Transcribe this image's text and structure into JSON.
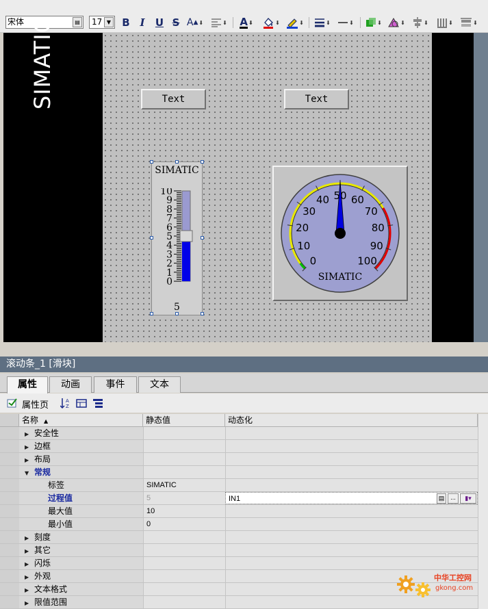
{
  "toolbar": {
    "font_name": "宋体",
    "font_size": "17",
    "bold": "B",
    "italic": "I",
    "underline": "U",
    "strike": "S",
    "case": "A",
    "font_color": "A"
  },
  "canvas": {
    "left_label": "SIMATIC",
    "button1_text": "Text",
    "button2_text": "Text",
    "slider": {
      "title": "SIMATIC",
      "scale_labels": [
        "10",
        "9",
        "8",
        "7",
        "6",
        "5",
        "4",
        "3",
        "2",
        "1",
        "0"
      ],
      "value": "5",
      "min": 0,
      "max": 10
    },
    "gauge": {
      "label": "SIMATIC",
      "scale_labels": [
        "0",
        "10",
        "20",
        "30",
        "40",
        "50",
        "60",
        "70",
        "80",
        "90",
        "100"
      ],
      "value": 50,
      "min": 0,
      "max": 100,
      "colors": {
        "face": "#9d9fd0",
        "needle": "#0000e0",
        "warning": "#e8e800",
        "danger": "#e00000",
        "ok": "#00c000"
      }
    }
  },
  "properties": {
    "title": "滚动条_1 [滑块]",
    "tabs": [
      "属性",
      "动画",
      "事件",
      "文本"
    ],
    "active_tab": "属性",
    "toolbar_label": "属性页",
    "columns": {
      "name": "名称",
      "static": "静态值",
      "dynamic": "动态化"
    },
    "rows": [
      {
        "name": "安全性",
        "expandable": true,
        "expanded": false
      },
      {
        "name": "边框",
        "expandable": true,
        "expanded": false
      },
      {
        "name": "布局",
        "expandable": true,
        "expanded": false
      },
      {
        "name": "常规",
        "expandable": true,
        "expanded": true,
        "highlight": true
      },
      {
        "name": "标签",
        "child": true,
        "static": "SIMATIC",
        "dynamic": ""
      },
      {
        "name": "过程值",
        "child": true,
        "highlight": true,
        "static": "5",
        "dynamic": "IN1"
      },
      {
        "name": "最大值",
        "child": true,
        "static": "10",
        "dynamic": ""
      },
      {
        "name": "最小值",
        "child": true,
        "static": "0",
        "dynamic": ""
      },
      {
        "name": "刻度",
        "expandable": true,
        "expanded": false
      },
      {
        "name": "其它",
        "expandable": true,
        "expanded": false
      },
      {
        "name": "闪烁",
        "expandable": true,
        "expanded": false
      },
      {
        "name": "外观",
        "expandable": true,
        "expanded": false
      },
      {
        "name": "文本格式",
        "expandable": true,
        "expanded": false
      },
      {
        "name": "限值范围",
        "expandable": true,
        "expanded": false
      }
    ]
  },
  "watermark": {
    "line1": "中华工控网",
    "line2": "gkong.com"
  }
}
